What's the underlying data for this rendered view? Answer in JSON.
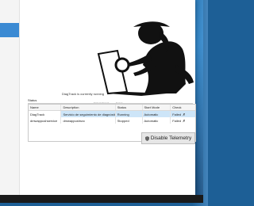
{
  "status_message": "DiagTrack is currently running",
  "group_label": "Status",
  "faint_labels": [
    "Statusinformat",
    "Servic"
  ],
  "table": {
    "columns": [
      "Name",
      "Description",
      "Status",
      "Start Mode",
      "Check"
    ],
    "rows": [
      {
        "name": "DiagTrack",
        "description": "Servicio de seguimiento de diagnósticos",
        "status": "Running",
        "start_mode": "Automatic",
        "check": "Failed",
        "selected": true
      },
      {
        "name": "dmwappushservice",
        "description": "dmwappushsvc",
        "status": "Stopped",
        "start_mode": "Automatic",
        "check": "Failed",
        "selected": false
      }
    ]
  },
  "disable_button": {
    "label": "Disable Telemetry",
    "icon": "shield-icon"
  },
  "colors": {
    "selection": "#cde5f8",
    "accent_strip": "#3b8ad3",
    "desktop": "#1f6aa5"
  }
}
